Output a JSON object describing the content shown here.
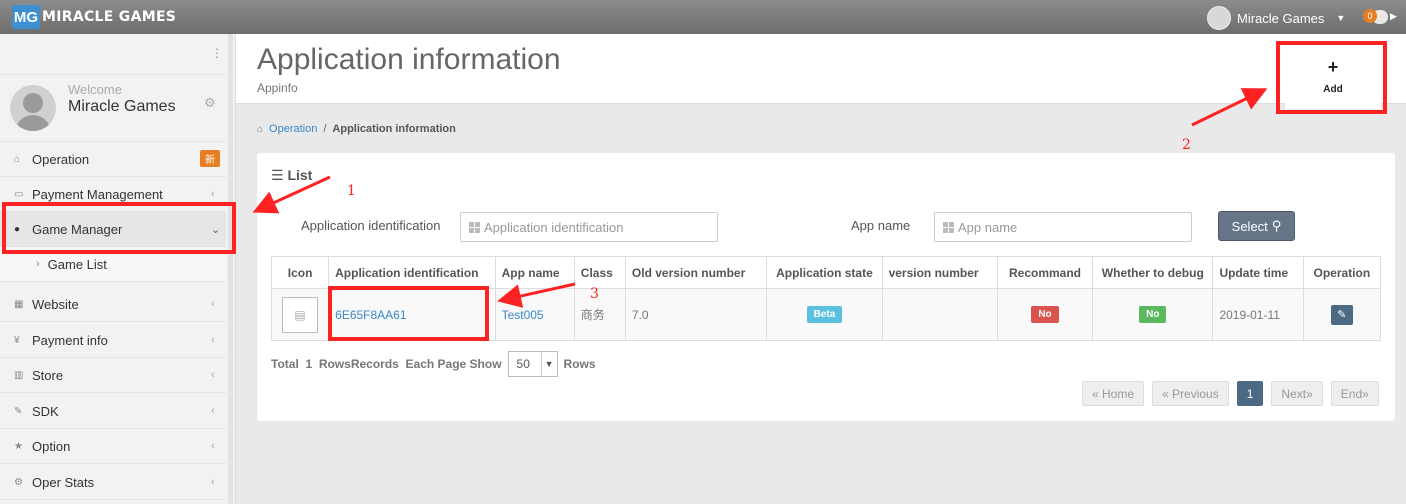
{
  "topbar": {
    "logo_mark": "MG",
    "logo_text": "MIRACLE GAMES",
    "user_name": "Miracle Games",
    "notif_count": "0"
  },
  "sidebar": {
    "welcome": "Welcome",
    "user_name": "Miracle Games",
    "items": [
      {
        "label": "Operation",
        "icon": "home-icon",
        "badge": "新"
      },
      {
        "label": "Payment Management",
        "icon": "monitor-icon"
      },
      {
        "label": "Game Manager",
        "icon": "user-icon"
      },
      {
        "label": "Game List"
      },
      {
        "label": "Website",
        "icon": "grid-icon"
      },
      {
        "label": "Payment info",
        "icon": "yen-icon"
      },
      {
        "label": "Store",
        "icon": "bar-chart-icon"
      },
      {
        "label": "SDK",
        "icon": "edit-icon"
      },
      {
        "label": "Option",
        "icon": "star-icon"
      },
      {
        "label": "Oper Stats",
        "icon": "gears-icon"
      }
    ]
  },
  "header": {
    "title": "Application information",
    "subtitle": "Appinfo",
    "add_label": "Add"
  },
  "breadcrumb": {
    "home": "Operation",
    "separator": "/",
    "current": "Application information"
  },
  "panel": {
    "title": "List",
    "filters": {
      "app_id_label": "Application identification",
      "app_id_placeholder": "Application identification",
      "app_name_label": "App name",
      "app_name_placeholder": "App name",
      "select_label": "Select"
    }
  },
  "table": {
    "headers": [
      "Icon",
      "Application identification",
      "App name",
      "Class",
      "Old version number",
      "Application state",
      "version number",
      "Recommand",
      "Whether to debug",
      "Update time",
      "Operation"
    ],
    "rows": [
      {
        "app_id": "6E65F8AA61",
        "app_name": "Test005",
        "class": "商务",
        "old_version": "7.0",
        "state": "Beta",
        "version": "",
        "recommend": "No",
        "debug": "No",
        "update_time": "2019-01-11"
      }
    ]
  },
  "pager": {
    "total_prefix": "Total",
    "total_count": "1",
    "total_suffix": "RowsRecords",
    "each_page": "Each Page Show",
    "page_size": "50",
    "rows_label": "Rows",
    "home": "« Home",
    "previous": "« Previous",
    "current": "1",
    "next": "Next»",
    "end": "End»"
  },
  "annotations": {
    "one": "1",
    "two": "2",
    "three": "3"
  },
  "colors": {
    "annotation": "#ff2222",
    "link": "#3a87c9",
    "select_button": "#667588",
    "state_beta": "#5bc0de",
    "recommend_no": "#d9534f",
    "debug_no": "#5cb85c"
  }
}
